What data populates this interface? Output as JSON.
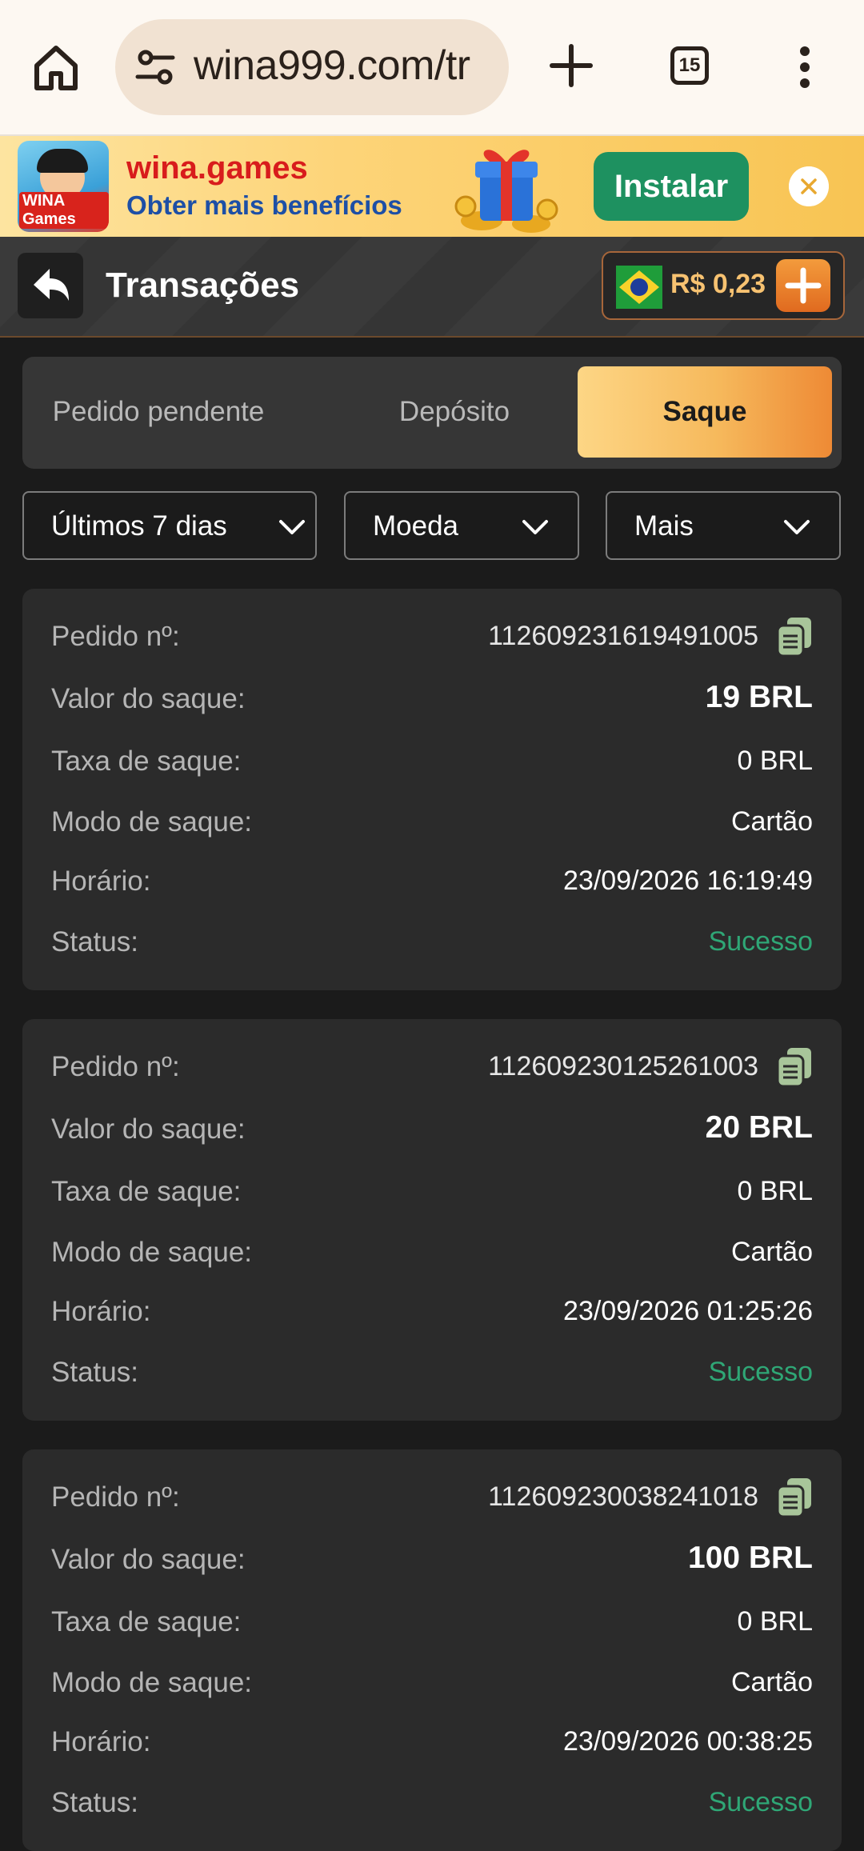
{
  "browser": {
    "url": "wina999.com/tr",
    "tab_count": "15"
  },
  "banner": {
    "logo_text": "WINA Games",
    "title": "wina.games",
    "subtitle": "Obter mais benefícios",
    "install_label": "Instalar"
  },
  "header": {
    "title": "Transações",
    "balance": "R$ 0,23"
  },
  "tabs": [
    {
      "label": "Pedido pendente",
      "active": false
    },
    {
      "label": "Depósito",
      "active": false
    },
    {
      "label": "Saque",
      "active": true
    }
  ],
  "filters": {
    "period": "Últimos 7 dias",
    "currency": "Moeda",
    "more": "Mais"
  },
  "labels": {
    "order": "Pedido nº:",
    "amount": "Valor do saque:",
    "fee": "Taxa de saque:",
    "mode": "Modo de saque:",
    "time": "Horário:",
    "status": "Status:"
  },
  "transactions": [
    {
      "order": "112609231619491005",
      "amount": "19 BRL",
      "fee": "0 BRL",
      "mode": "Cartão",
      "time": "23/09/2026 16:19:49",
      "status": "Sucesso"
    },
    {
      "order": "112609230125261003",
      "amount": "20 BRL",
      "fee": "0 BRL",
      "mode": "Cartão",
      "time": "23/09/2026 01:25:26",
      "status": "Sucesso"
    },
    {
      "order": "112609230038241018",
      "amount": "100 BRL",
      "fee": "0 BRL",
      "mode": "Cartão",
      "time": "23/09/2026 00:38:25",
      "status": "Sucesso"
    }
  ],
  "colors": {
    "accent": "#f6b95c",
    "success": "#2fa776",
    "install": "#1e9160"
  }
}
